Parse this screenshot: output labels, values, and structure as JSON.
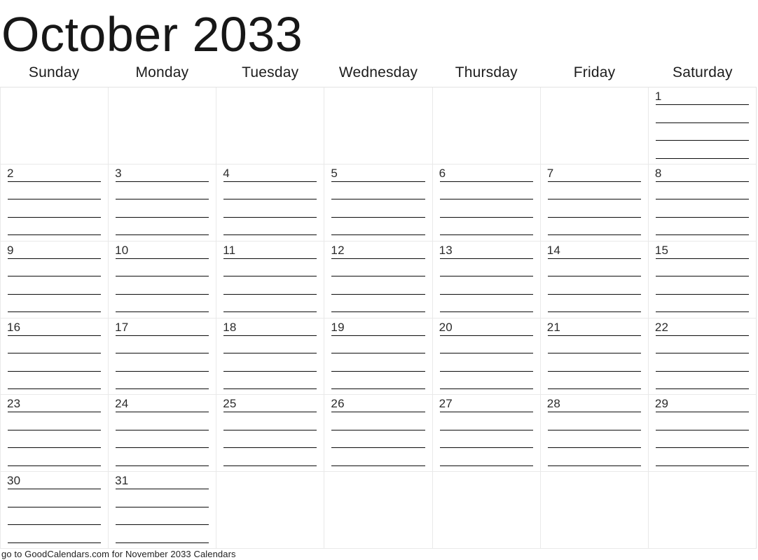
{
  "calendar": {
    "title": "October 2033",
    "month": "October",
    "year": "2033",
    "weekdays": [
      "Sunday",
      "Monday",
      "Tuesday",
      "Wednesday",
      "Thursday",
      "Friday",
      "Saturday"
    ],
    "lines_per_cell": 4,
    "weeks": [
      [
        "",
        "",
        "",
        "",
        "",
        "",
        "1"
      ],
      [
        "2",
        "3",
        "4",
        "5",
        "6",
        "7",
        "8"
      ],
      [
        "9",
        "10",
        "11",
        "12",
        "13",
        "14",
        "15"
      ],
      [
        "16",
        "17",
        "18",
        "19",
        "20",
        "21",
        "22"
      ],
      [
        "23",
        "24",
        "25",
        "26",
        "27",
        "28",
        "29"
      ],
      [
        "30",
        "31",
        "",
        "",
        "",
        "",
        ""
      ]
    ],
    "colors": {
      "text": "#1a1a1a",
      "grid_border": "#e9e9e9",
      "writing_line": "#0d0d0d",
      "background": "#ffffff"
    }
  },
  "footer": {
    "text": "go to GoodCalendars.com for November 2033 Calendars"
  }
}
